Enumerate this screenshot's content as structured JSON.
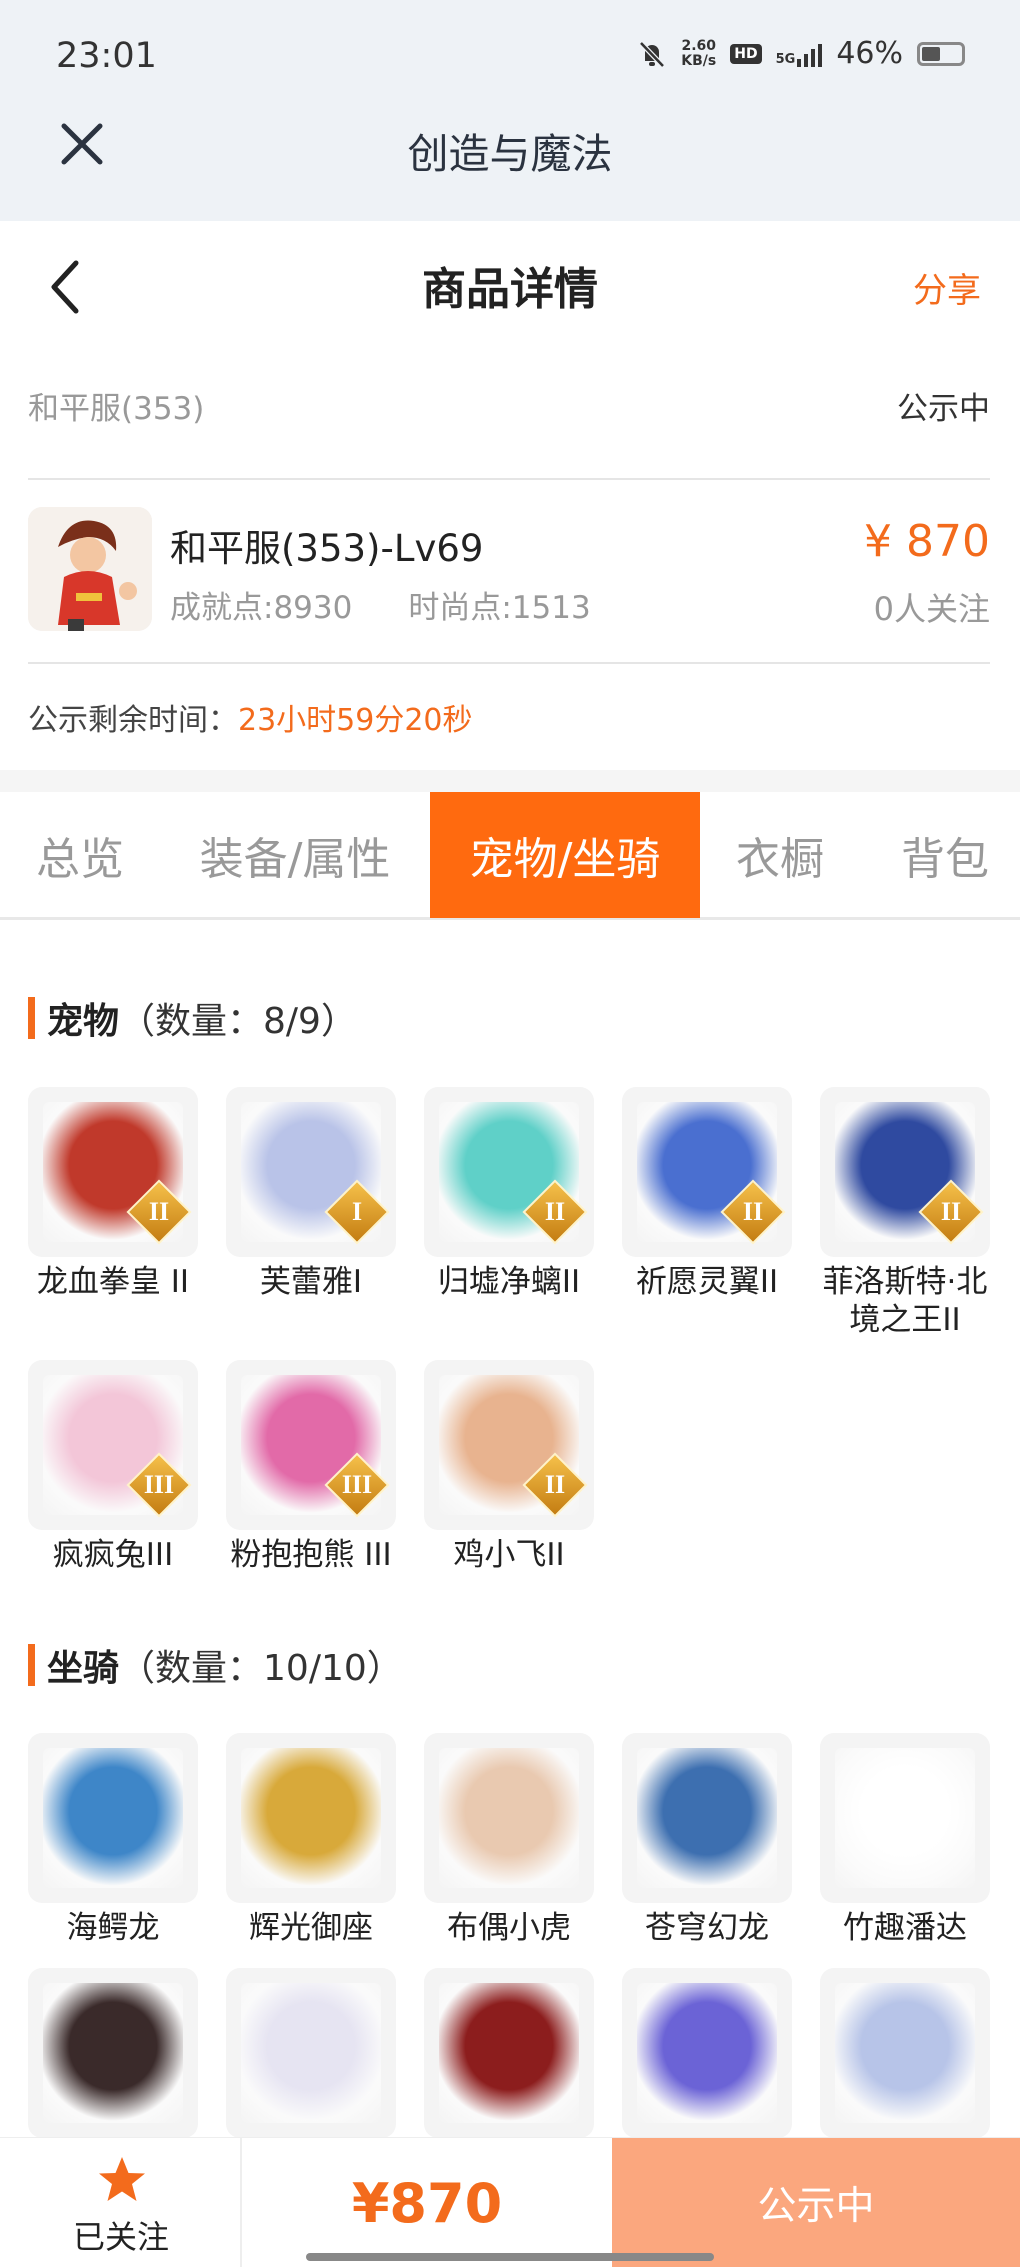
{
  "status_bar": {
    "time": "23:01",
    "net_speed_value": "2.60",
    "net_speed_unit": "KB/s",
    "hd": "HD",
    "network": "5G",
    "battery": "46%"
  },
  "app": {
    "title": "创造与魔法",
    "close_icon": "close-icon"
  },
  "header": {
    "title": "商品详情",
    "share_label": "分享",
    "back_icon": "back-arrow-icon"
  },
  "product": {
    "server": "和平服(353)",
    "status": "公示中",
    "name": "和平服(353)-Lv69",
    "achievement": "成就点:8930",
    "fashion": "时尚点:1513",
    "price": "¥ 870",
    "followers": "0人关注",
    "countdown_label": "公示剩余时间：",
    "countdown_value": "23小时59分20秒"
  },
  "tabs": [
    {
      "label": "总览",
      "active": false
    },
    {
      "label": "装备/属性",
      "active": false
    },
    {
      "label": "宠物/坐骑",
      "active": true
    },
    {
      "label": "衣橱",
      "active": false
    },
    {
      "label": "背包",
      "active": false
    }
  ],
  "pets": {
    "title": "宠物",
    "count": "（数量：8/9）",
    "items": [
      {
        "name": "龙血拳皇 II",
        "badge": "II",
        "color": "#c0392b"
      },
      {
        "name": "芙蕾雅I",
        "badge": "I",
        "color": "#b9c3e8"
      },
      {
        "name": "归墟净螭II",
        "badge": "II",
        "color": "#5fd0c8"
      },
      {
        "name": "祈愿灵翼II",
        "badge": "II",
        "color": "#4a6fd0"
      },
      {
        "name": "菲洛斯特·北境之王II",
        "badge": "II",
        "color": "#2f4aa0"
      },
      {
        "name": "疯疯兔III",
        "badge": "III",
        "color": "#f3c6d8"
      },
      {
        "name": "粉抱抱熊 III",
        "badge": "III",
        "color": "#e26aa8"
      },
      {
        "name": "鸡小飞II",
        "badge": "II",
        "color": "#e8b38f"
      }
    ]
  },
  "mounts": {
    "title": "坐骑",
    "count": "（数量：10/10）",
    "items": [
      {
        "name": "海鳄龙",
        "color": "#3e86c8"
      },
      {
        "name": "辉光御座",
        "color": "#d8a93a"
      },
      {
        "name": "布偶小虎",
        "color": "#e9c9b0"
      },
      {
        "name": "苍穹幻龙",
        "color": "#3d6fb0"
      },
      {
        "name": "竹趣潘达",
        "color": "#ffffff"
      },
      {
        "name": "",
        "color": "#3a2a2a"
      },
      {
        "name": "",
        "color": "#e6e4f2"
      },
      {
        "name": "",
        "color": "#8c1d1d"
      },
      {
        "name": "",
        "color": "#6b63d6"
      },
      {
        "name": "",
        "color": "#b7c4e8"
      }
    ]
  },
  "bottom_bar": {
    "follow_label": "已关注",
    "price": "¥870",
    "action_label": "公示中"
  },
  "colors": {
    "accent": "#f36b1c",
    "tab_active": "#ff6a0f",
    "action_button": "#fba77e"
  }
}
